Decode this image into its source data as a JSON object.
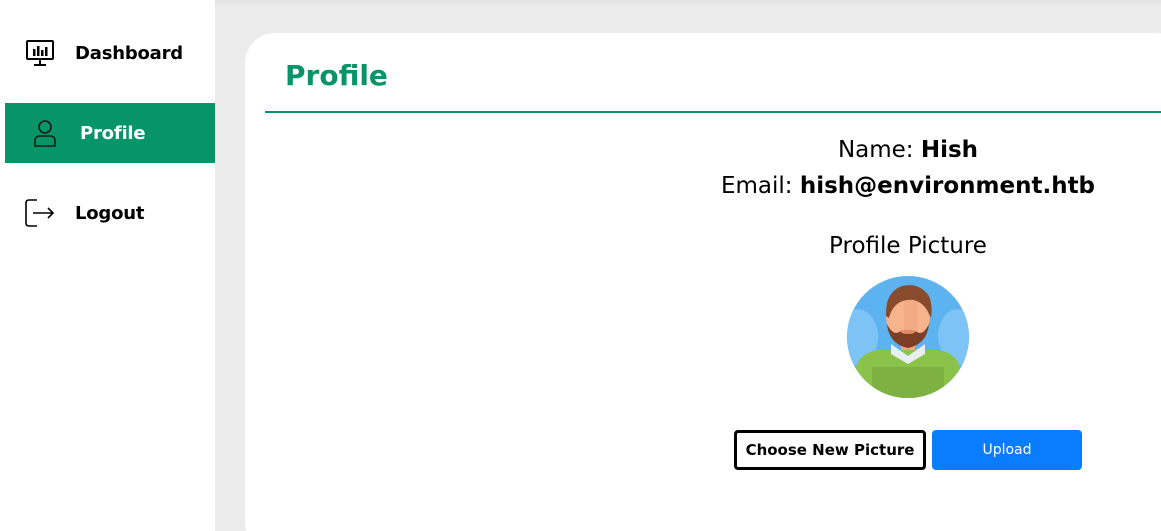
{
  "sidebar": {
    "items": [
      {
        "label": "Dashboard",
        "icon": "dashboard-monitor-icon"
      },
      {
        "label": "Profile",
        "icon": "user-icon",
        "active": true
      },
      {
        "label": "Logout",
        "icon": "logout-icon"
      }
    ],
    "active_color": "#079466"
  },
  "main": {
    "title": "Profile",
    "name_label": "Name:",
    "name_value": "Hish",
    "email_label": "Email:",
    "email_value": "hish@environment.htb",
    "picture_title": "Profile Picture",
    "avatar_icon": "male-avatar-icon",
    "choose_button_label": "Choose New Picture",
    "upload_button_label": "Upload",
    "accent_color": "#079466",
    "upload_color": "#0a7cff"
  }
}
